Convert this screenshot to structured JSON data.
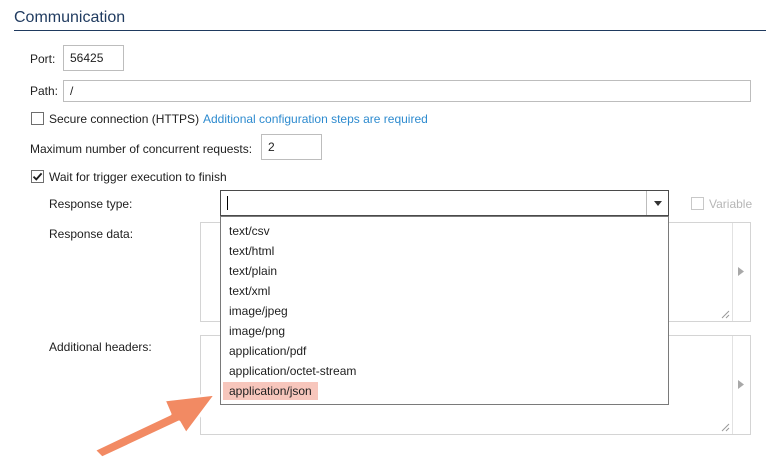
{
  "section": {
    "title": "Communication"
  },
  "port": {
    "label": "Port:",
    "value": "56425"
  },
  "path": {
    "label": "Path:",
    "value": "/"
  },
  "secure": {
    "label": "Secure connection (HTTPS)",
    "checked": false,
    "link": "Additional configuration steps are required"
  },
  "max_requests": {
    "label": "Maximum number of concurrent requests:",
    "value": "2"
  },
  "wait_trigger": {
    "label": "Wait for trigger execution to finish",
    "checked": true
  },
  "response_type": {
    "label": "Response type:",
    "value": "",
    "variable_label": "Variable",
    "options": [
      "text/csv",
      "text/html",
      "text/plain",
      "text/xml",
      "image/jpeg",
      "image/png",
      "application/pdf",
      "application/octet-stream",
      "application/json"
    ],
    "highlighted_option": "application/json"
  },
  "response_data": {
    "label": "Response data:"
  },
  "additional_headers": {
    "label": "Additional headers:"
  },
  "colors": {
    "section_title": "#1f3a5f",
    "link": "#2e8bcf",
    "highlight": "#f7c6bc",
    "arrow": "#f28a63"
  }
}
